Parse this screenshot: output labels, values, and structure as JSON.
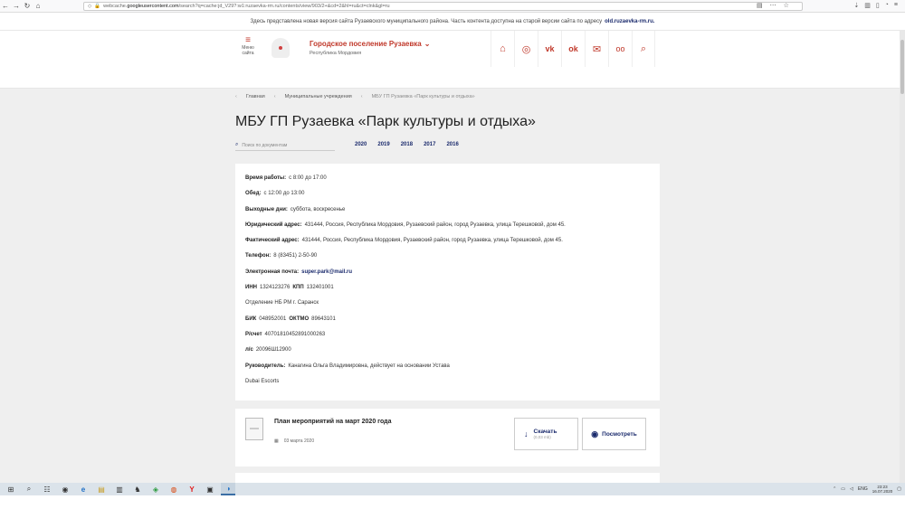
{
  "browser": {
    "url_prefix": "webcache.",
    "url_host": "googleusercontent.com",
    "url_rest": "/search?q=cache:jd_V29?:w1:ruzaevka-rm.ru/contents/view/903/2+&cd=2&hl=ru&ct=clnk&gl=ru",
    "back_icon": "←",
    "forward_icon": "→",
    "reload_icon": "↻",
    "home_icon": "⌂"
  },
  "notice": {
    "text": "Здесь представлена новая версия сайта Рузаевского муниципального района. Часть контента доступна на старой версии сайта по адресу",
    "link": "old.ruzaevka-rm.ru."
  },
  "header": {
    "menu_label": "Меню сайта",
    "title": "Городское поселение Рузаевка",
    "subtitle": "Республика Мордовия",
    "social": [
      {
        "name": "home-icon",
        "glyph": "⌂"
      },
      {
        "name": "instagram-icon",
        "glyph": "◎"
      },
      {
        "name": "vk-icon",
        "glyph": "vk"
      },
      {
        "name": "odnoklassniki-icon",
        "glyph": "ok"
      },
      {
        "name": "mail-icon",
        "glyph": "✉"
      },
      {
        "name": "glasses-icon",
        "glyph": "oo"
      },
      {
        "name": "search-icon",
        "glyph": "⌕"
      }
    ]
  },
  "breadcrumb": {
    "home": "Главная",
    "section": "Муниципальные учреждения",
    "current": "МБУ ГП Рузаевка «Парк культуры и отдыха»"
  },
  "page": {
    "title": "МБУ ГП Рузаевка «Парк культуры и отдыха»",
    "search_placeholder": "Поиск по документам",
    "years": [
      "2020",
      "2019",
      "2018",
      "2017",
      "2016"
    ]
  },
  "info": {
    "hours_label": "Время работы:",
    "hours_value": "с 8:00 до 17:00",
    "lunch_label": "Обед:",
    "lunch_value": "с 12:00 до 13:00",
    "weekend_label": "Выходные дни:",
    "weekend_value": "суббота, воскресенье",
    "legal_label": "Юридический адрес:",
    "legal_value": "431444, Россия, Республика Мордовия, Рузаевский район, город Рузаевка, улица Терешковой, дом 45.",
    "actual_label": "Фактический адрес:",
    "actual_value": "431444, Россия, Республика Мордовия, Рузаевский район, город Рузаевка, улица Терешковой, дом 45.",
    "phone_label": "Телефон:",
    "phone_value": "8 (83451) 2-50-90",
    "email_label": "Электронная почта:",
    "email_value": "super.park@mail.ru",
    "inn_label": "ИНН",
    "inn_value": "1324123276",
    "kpp_label": "КПП",
    "kpp_value": "132401001",
    "bank": "Отделение НБ РМ г. Саранск",
    "bik_label": "БИК",
    "bik_value": "048952001",
    "oktmo_label": "ОКТМО",
    "oktmo_value": "89643101",
    "rs_label": "Р/счет",
    "rs_value": "40701810452891000263",
    "ls_label": "л/с",
    "ls_value": "20096Ш12900",
    "head_label": "Руководитель:",
    "head_value": "Канагина Ольга Владимировна, действует на основании Устава",
    "extra": "Dubai Escorts"
  },
  "document": {
    "title": "План мероприятий на март 2020 года",
    "date": "03 марта 2020",
    "download_label": "Скачать",
    "download_size": "(0,03 mb)",
    "view_label": "Посмотреть"
  },
  "taskbar": {
    "icons": [
      "⊞",
      "⌕",
      "☷",
      "◉",
      "e",
      "▤",
      "▥",
      "♞",
      "◈",
      "◍",
      "Y",
      "▣",
      "◑"
    ],
    "lang": "ENG",
    "time": "23:23",
    "date": "16.07.2020"
  }
}
